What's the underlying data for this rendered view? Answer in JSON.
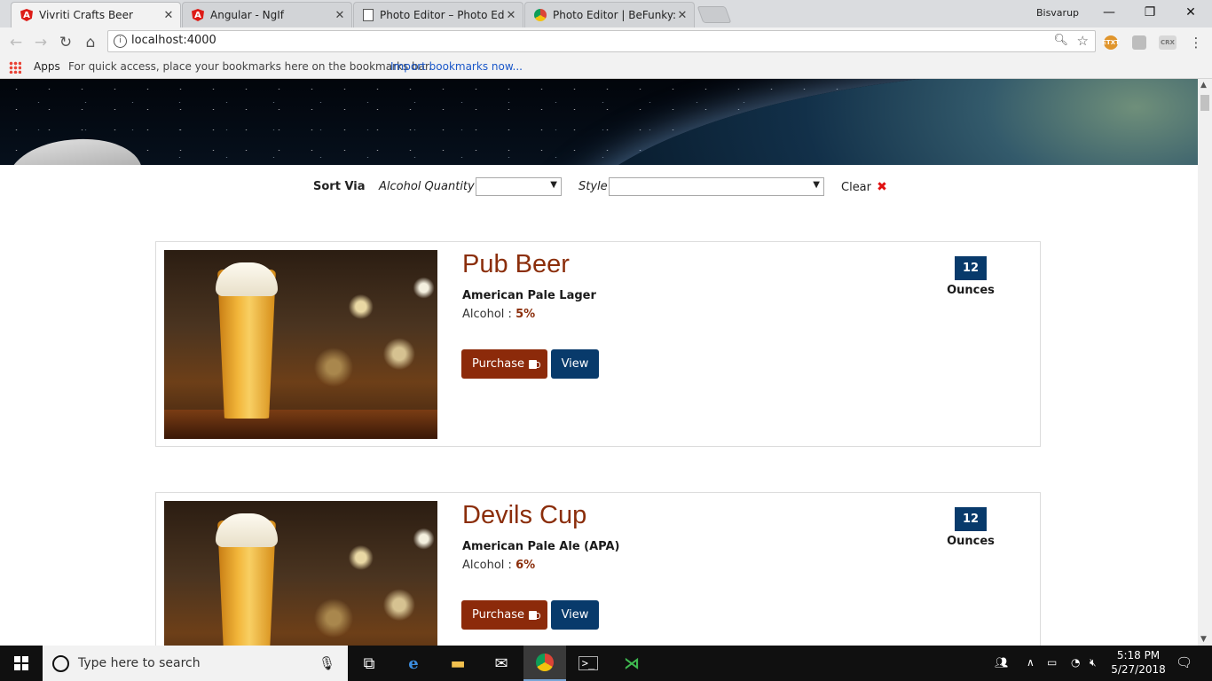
{
  "browser": {
    "tabs": [
      {
        "title": "Vivriti Crafts Beer",
        "favicon": "angular-icon",
        "active": true
      },
      {
        "title": "Angular - NgIf",
        "favicon": "angular-icon",
        "active": false
      },
      {
        "title": "Photo Editor – Photo Edit",
        "favicon": "document-icon",
        "active": false
      },
      {
        "title": "Photo Editor | BeFunky: F",
        "favicon": "chrome-icon",
        "active": false
      }
    ],
    "profile_name": "Bisvarup",
    "url": "localhost:4000",
    "bookmarks": {
      "apps_label": "Apps",
      "hint": "For quick access, place your bookmarks here on the bookmarks bar.",
      "import_link": "Import bookmarks now..."
    },
    "extensions": [
      "ETXT",
      "CRX"
    ]
  },
  "sort_bar": {
    "sort_label": "Sort Via",
    "alcohol_label": "Alcohol Quantity",
    "alcohol_value": "",
    "style_label": "Style",
    "style_value": "",
    "clear_label": "Clear",
    "clear_icon": "✖"
  },
  "beers": [
    {
      "name": "Pub Beer",
      "style": "American Pale Lager",
      "alcohol_label": "Alcohol : ",
      "alcohol_value": "5%",
      "ounces": "12",
      "ounces_label": "Ounces",
      "purchase_label": "Purchase",
      "view_label": "View"
    },
    {
      "name": "Devils Cup",
      "style": "American Pale Ale (APA)",
      "alcohol_label": "Alcohol : ",
      "alcohol_value": "6%",
      "ounces": "12",
      "ounces_label": "Ounces",
      "purchase_label": "Purchase",
      "view_label": "View"
    }
  ],
  "taskbar": {
    "search_placeholder": "Type here to search",
    "time": "5:18 PM",
    "date": "5/27/2018"
  },
  "colors": {
    "beer_name": "#8b2e0b",
    "purchase_button": "#8c2a0a",
    "view_button": "#083a6b",
    "ounce_badge": "#083a6b",
    "clear_icon": "#e01010"
  }
}
